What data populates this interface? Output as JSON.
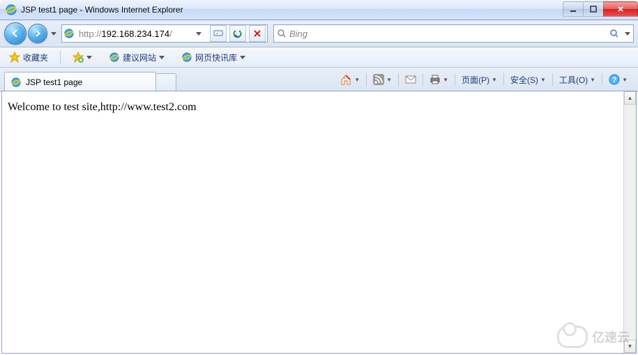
{
  "window": {
    "title": "JSP test1 page - Windows Internet Explorer"
  },
  "nav": {
    "url_prefix": "http://",
    "url_host": "192.168.234.174",
    "url_suffix": "/",
    "search_placeholder": "Bing"
  },
  "favorites": {
    "label": "收藏夹",
    "suggested": "建议网站",
    "webslices": "网页快讯库"
  },
  "tab": {
    "title": "JSP test1 page"
  },
  "commands": {
    "page": "页面(P)",
    "safety": "安全(S)",
    "tools": "工具(O)"
  },
  "page": {
    "body": "Welcome to test site,http://www.test2.com"
  },
  "watermark": {
    "text": "亿速云"
  }
}
